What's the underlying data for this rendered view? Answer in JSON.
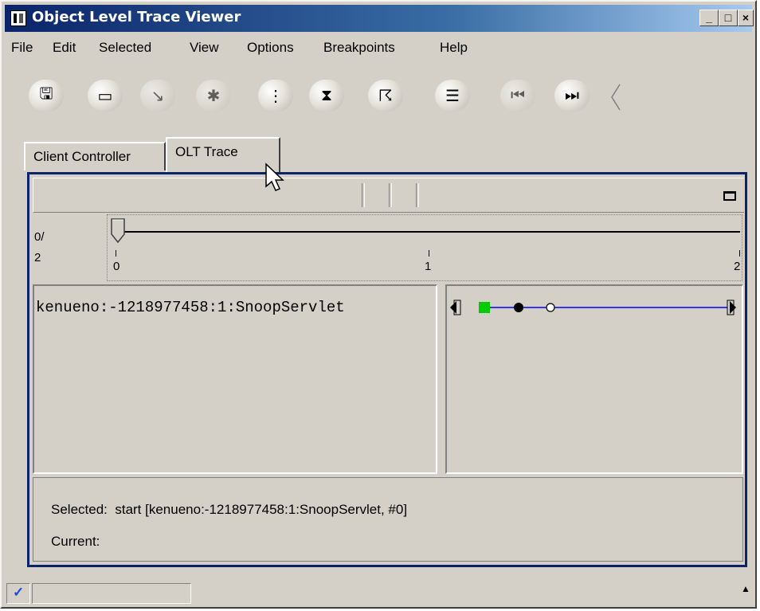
{
  "window": {
    "title": "Object Level Trace Viewer",
    "minimize": "_",
    "maximize": "□",
    "close": "×"
  },
  "menu": [
    "File",
    "Edit",
    "Selected",
    "View",
    "Options",
    "Breakpoints",
    "Help"
  ],
  "toolbar": [
    {
      "name": "save-icon",
      "glyph": "🖫",
      "enabled": true
    },
    {
      "name": "dialog-icon",
      "glyph": "▭",
      "enabled": true
    },
    {
      "name": "step-icon",
      "glyph": "↘",
      "enabled": false
    },
    {
      "name": "debug-icon",
      "glyph": "✱",
      "enabled": false
    },
    {
      "name": "tree-icon",
      "glyph": "⋮",
      "enabled": true
    },
    {
      "name": "hourglass-icon",
      "glyph": "⧗",
      "enabled": true
    },
    {
      "name": "run-icon",
      "glyph": "☈",
      "enabled": true
    },
    {
      "name": "list-icon",
      "glyph": "☰",
      "enabled": true
    },
    {
      "name": "first-icon",
      "glyph": "⏮",
      "enabled": false
    },
    {
      "name": "last-icon",
      "glyph": "⏭",
      "enabled": true
    }
  ],
  "tabs": {
    "client_controller": "Client Controller",
    "olt_trace": "OLT Trace"
  },
  "timeline": {
    "position_label_top": "0/",
    "position_label_bottom": "2",
    "ticks": [
      "0",
      "1",
      "2"
    ],
    "current": 0,
    "max": 2
  },
  "trace": {
    "object_name": "kenueno:-1218977458:1:SnoopServlet",
    "colors": {
      "line": "#0000ff",
      "start_node": "#00cc00"
    }
  },
  "status": {
    "selected_label": "Selected:",
    "selected_value": "start [kenueno:-1218977458:1:SnoopServlet, #0]",
    "current_label": "Current:",
    "current_value": ""
  },
  "statusbar": {
    "check_icon": "✓",
    "scroll_icon": "▲"
  }
}
